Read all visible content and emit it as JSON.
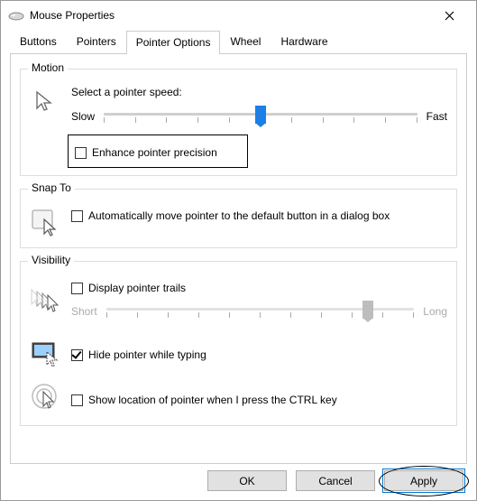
{
  "window": {
    "title": "Mouse Properties"
  },
  "tabs": {
    "t0": "Buttons",
    "t1": "Pointers",
    "t2": "Pointer Options",
    "t3": "Wheel",
    "t4": "Hardware"
  },
  "motion": {
    "legend": "Motion",
    "speed_label": "Select a pointer speed:",
    "slow": "Slow",
    "fast": "Fast",
    "enhance": "Enhance pointer precision",
    "enhance_checked": false,
    "slider_position_pct": 50
  },
  "snapto": {
    "legend": "Snap To",
    "auto": "Automatically move pointer to the default button in a dialog box",
    "auto_checked": false
  },
  "visibility": {
    "legend": "Visibility",
    "trails": "Display pointer trails",
    "trails_checked": false,
    "short": "Short",
    "long": "Long",
    "hide": "Hide pointer while typing",
    "hide_checked": true,
    "ctrl": "Show location of pointer when I press the CTRL key",
    "ctrl_checked": false
  },
  "buttons": {
    "ok": "OK",
    "cancel": "Cancel",
    "apply": "Apply"
  }
}
